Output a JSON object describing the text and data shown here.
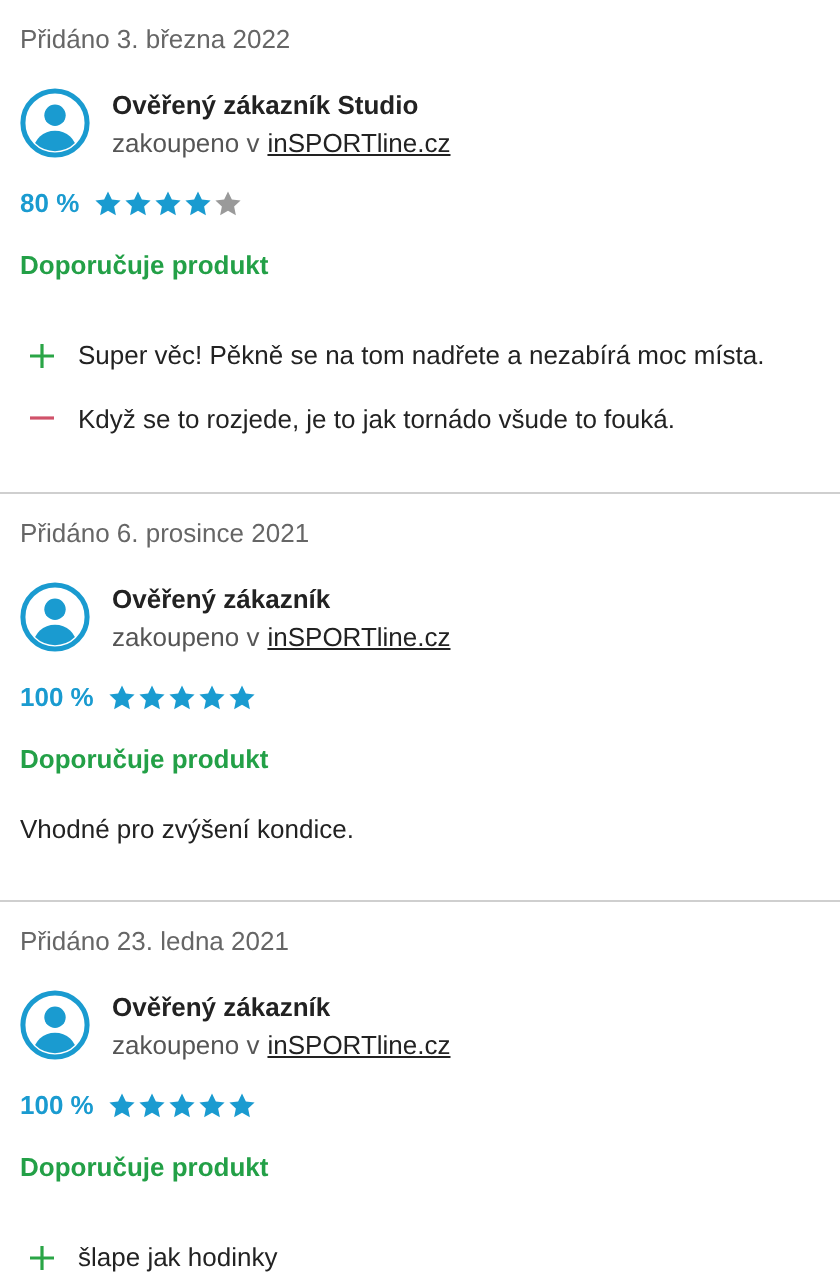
{
  "reviews": [
    {
      "date": "Přidáno 3. března 2022",
      "author": "Ověřený zákazník Studio",
      "purchased": "zakoupeno v",
      "shop": "inSPORTline.cz",
      "rating": "80 %",
      "stars": 4,
      "recommendation": "Doporučuje produkt",
      "points": [
        {
          "kind": "plus",
          "text": "Super věc! Pěkně se na tom nadřete a nezabírá moc místa."
        },
        {
          "kind": "minus",
          "text": "Když se to rozjede, je to jak tornádo všude to fouká."
        }
      ]
    },
    {
      "date": "Přidáno 6. prosince 2021",
      "author": "Ověřený zákazník",
      "purchased": "zakoupeno v",
      "shop": "inSPORTline.cz",
      "rating": "100 %",
      "stars": 5,
      "recommendation": "Doporučuje produkt",
      "comment": "Vhodné pro zvýšení kondice."
    },
    {
      "date": "Přidáno 23. ledna 2021",
      "author": "Ověřený zákazník",
      "purchased": "zakoupeno v",
      "shop": "inSPORTline.cz",
      "rating": "100 %",
      "stars": 5,
      "recommendation": "Doporučuje produkt",
      "points": [
        {
          "kind": "plus",
          "text": "šlape jak hodinky"
        }
      ]
    }
  ]
}
